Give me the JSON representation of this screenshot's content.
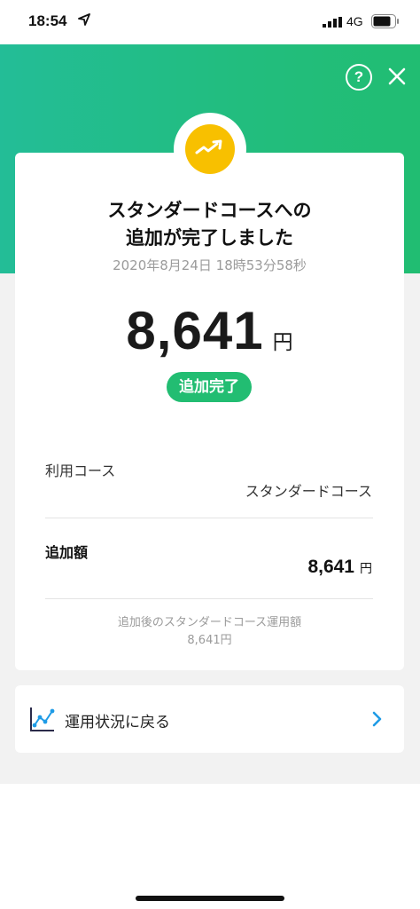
{
  "status_bar": {
    "time": "18:54",
    "network": "4G"
  },
  "header": {
    "help_label": "?"
  },
  "result": {
    "title_line1": "スタンダードコースへの",
    "title_line2": "追加が完了しました",
    "datetime": "2020年8月24日 18時53分58秒",
    "amount": "8,641",
    "amount_unit": "円",
    "status": "追加完了"
  },
  "details": {
    "course_label": "利用コース",
    "course_value": "スタンダードコース",
    "added_label": "追加額",
    "added_value": "8,641",
    "added_unit": "円",
    "note_line1": "追加後のスタンダードコース運用額",
    "note_line2": "8,641円"
  },
  "link": {
    "label": "運用状況に戻る"
  },
  "colors": {
    "accent_green": "#22bd72",
    "badge_yellow": "#f8c000",
    "link_blue": "#1e9be6"
  }
}
